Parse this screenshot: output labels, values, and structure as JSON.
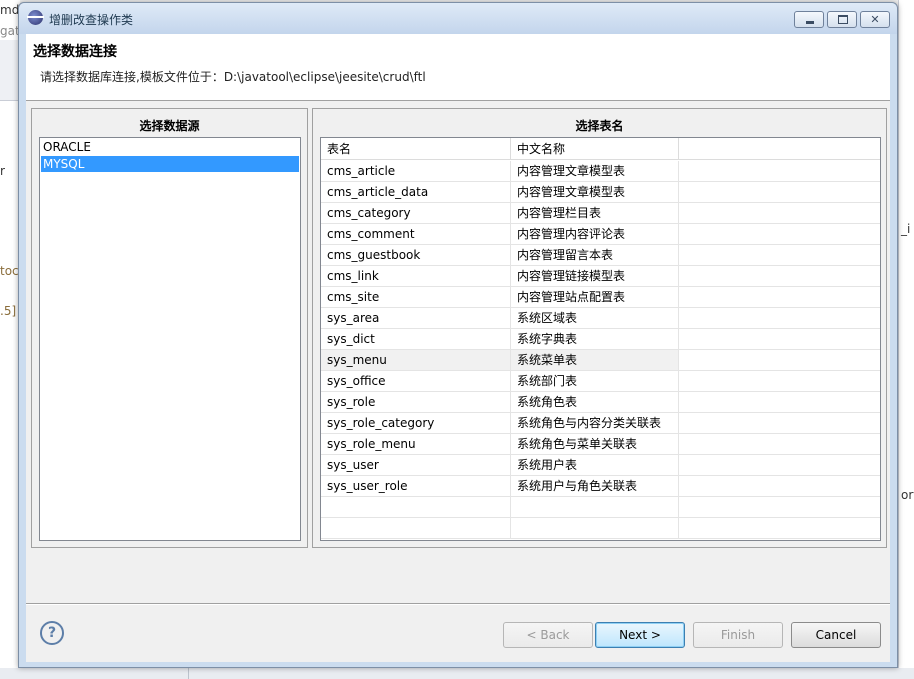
{
  "background": {
    "left_fragments": [
      "md",
      "gate",
      "r",
      "toc",
      ".5]"
    ],
    "right_fragments": [
      "_i",
      "ory"
    ]
  },
  "window": {
    "title": "增删改查操作类",
    "icon": "eclipse-icon"
  },
  "header": {
    "title": "选择数据连接",
    "message": "请选择数据库连接,模板文件位于：D:\\javatool\\eclipse\\jeesite\\crud\\ftl"
  },
  "datasource": {
    "label": "选择数据源",
    "items": [
      "ORACLE",
      "MYSQL"
    ],
    "selected": "MYSQL"
  },
  "tables": {
    "label": "选择表名",
    "columns": [
      "表名",
      "中文名称",
      ""
    ],
    "rows": [
      {
        "name": "cms_article",
        "cn": "内容管理文章模型表"
      },
      {
        "name": "cms_article_data",
        "cn": "内容管理文章模型表"
      },
      {
        "name": "cms_category",
        "cn": "内容管理栏目表"
      },
      {
        "name": "cms_comment",
        "cn": "内容管理内容评论表"
      },
      {
        "name": "cms_guestbook",
        "cn": "内容管理留言本表"
      },
      {
        "name": "cms_link",
        "cn": "内容管理链接模型表"
      },
      {
        "name": "cms_site",
        "cn": "内容管理站点配置表"
      },
      {
        "name": "sys_area",
        "cn": "系统区域表"
      },
      {
        "name": "sys_dict",
        "cn": "系统字典表"
      },
      {
        "name": "sys_menu",
        "cn": "系统菜单表"
      },
      {
        "name": "sys_office",
        "cn": "系统部门表"
      },
      {
        "name": "sys_role",
        "cn": "系统角色表"
      },
      {
        "name": "sys_role_category",
        "cn": "系统角色与内容分类关联表"
      },
      {
        "name": "sys_role_menu",
        "cn": "系统角色与菜单关联表"
      },
      {
        "name": "sys_user",
        "cn": "系统用户表"
      },
      {
        "name": "sys_user_role",
        "cn": "系统用户与角色关联表"
      },
      {
        "name": "",
        "cn": ""
      },
      {
        "name": "",
        "cn": ""
      }
    ],
    "highlighted": "sys_menu"
  },
  "buttons": {
    "back": "< Back",
    "next": "Next >",
    "finish": "Finish",
    "cancel": "Cancel",
    "help": "?"
  }
}
